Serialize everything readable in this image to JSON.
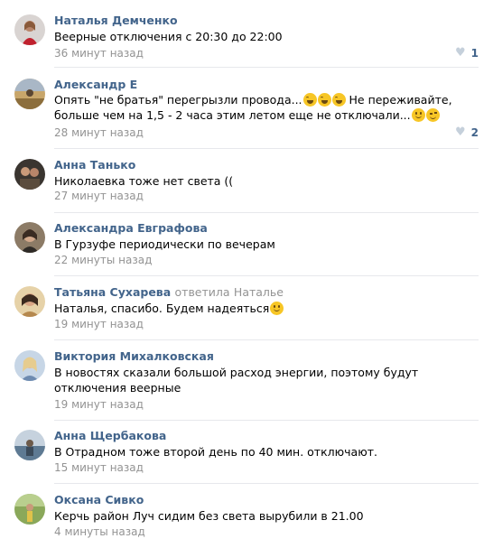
{
  "comments": [
    {
      "author": "Наталья Демченко",
      "text": "Веерные отключения с 20:30 до 22:00",
      "time": "36 минут назад",
      "likes": "1"
    },
    {
      "author": "Александр Е",
      "text": "Опять \"не братья\" перегрызли провода...",
      "text2": " Не переживайте, больше чем на 1,5 - 2 часа этим летом еще не отключали...",
      "time": "28 минут назад",
      "likes": "2"
    },
    {
      "author": "Анна Танько",
      "text": "Николаевка тоже нет света ((",
      "time": "27 минут назад"
    },
    {
      "author": "Александра Евграфова",
      "text": "В Гурзуфе периодически по вечерам",
      "time": "22 минуты назад"
    },
    {
      "author": "Татьяна Сухарева",
      "reply_label": "ответила",
      "reply_to": "Наталье",
      "text": "Наталья, спасибо. Будем надеяться",
      "time": "19 минут назад"
    },
    {
      "author": "Виктория Михалковская",
      "text": "В новостях сказали большой расход энергии, поэтому будут отключения веерные",
      "time": "19 минут назад"
    },
    {
      "author": "Анна Щербакова",
      "text": "В Отрадном тоже второй день по 40 мин. отключают.",
      "time": "15 минут назад"
    },
    {
      "author": "Оксана Сивко",
      "text": "Керчь район Луч сидим без света вырубили в 21.00",
      "time": "4 минуты назад"
    }
  ],
  "icons": {
    "like": "heart-icon",
    "emoji_laugh": "laughing-emoji-icon",
    "emoji_smile": "smiling-emoji-icon",
    "emoji_wink": "winking-emoji-icon"
  },
  "colors": {
    "author": "#42648b",
    "meta": "#939393",
    "divider": "#e7e8ec",
    "heart": "#c5d0db"
  }
}
